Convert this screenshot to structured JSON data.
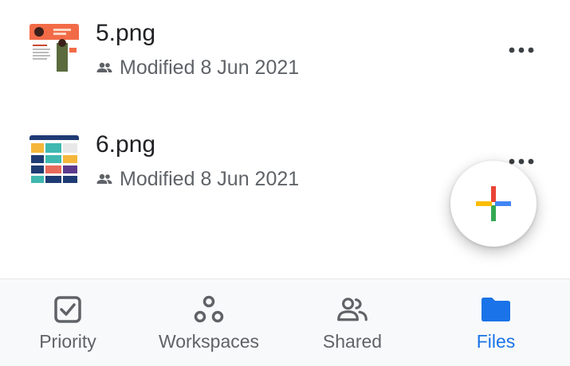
{
  "files": [
    {
      "name": "5.png",
      "modified": "Modified 8 Jun 2021",
      "shared_icon": "people-icon",
      "thumbnail_icon": "image-thumbnail"
    },
    {
      "name": "6.png",
      "modified": "Modified 8 Jun 2021",
      "shared_icon": "people-icon",
      "thumbnail_icon": "image-thumbnail"
    }
  ],
  "more_icon": "more-horizontal-icon",
  "fab": {
    "icon": "plus-icon",
    "colors": [
      "#ea4335",
      "#4285f4",
      "#34a853",
      "#fbbc04"
    ]
  },
  "bottom_nav": {
    "items": [
      {
        "label": "Priority",
        "icon": "checkbox-icon",
        "active": false
      },
      {
        "label": "Workspaces",
        "icon": "workspaces-icon",
        "active": false
      },
      {
        "label": "Shared",
        "icon": "shared-people-icon",
        "active": false
      },
      {
        "label": "Files",
        "icon": "folder-icon",
        "active": true
      }
    ],
    "active_color": "#1a73e8",
    "inactive_color": "#5f6368"
  }
}
